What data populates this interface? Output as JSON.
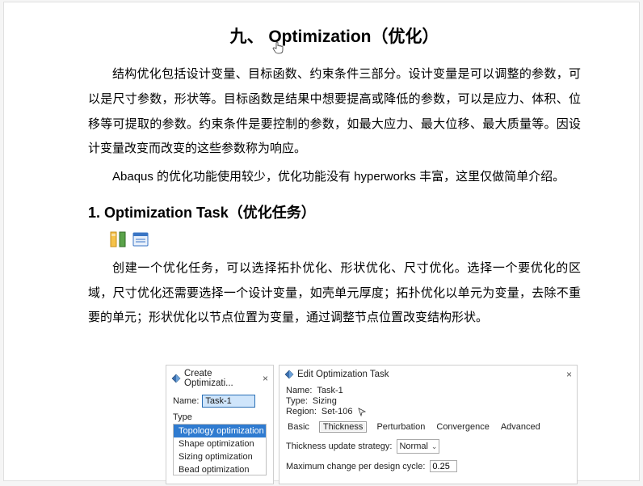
{
  "title": "九、 Optimization（优化）",
  "para1": "结构优化包括设计变量、目标函数、约束条件三部分。设计变量是可以调整的参数，可以是尺寸参数，形状等。目标函数是结果中想要提高或降低的参数，可以是应力、体积、位移等可提取的参数。约束条件是要控制的参数，如最大应力、最大位移、最大质量等。因设计变量改变而改变的这些参数称为响应。",
  "para2": "Abaqus 的优化功能使用较少，优化功能没有 hyperworks 丰富，这里仅做简单介绍。",
  "heading2": "1.  Optimization Task（优化任务）",
  "para3": "创建一个优化任务，可以选择拓扑优化、形状优化、尺寸优化。选择一个要优化的区域，尺寸优化还需要选择一个设计变量，如壳单元厚度；拓扑优化以单元为变量，去除不重要的单元；形状优化以节点位置为变量，通过调整节点位置改变结构形状。",
  "dlg1": {
    "title": "Create Optimizati...",
    "nameLabel": "Name:",
    "nameValue": "Task-1",
    "typeLabel": "Type",
    "options": [
      "Topology optimization",
      "Shape optimization",
      "Sizing optimization",
      "Bead optimization"
    ]
  },
  "dlg2": {
    "title": "Edit Optimization Task",
    "nameLabel": "Name:",
    "nameValue": "Task-1",
    "typeLabel": "Type:",
    "typeValue": "Sizing",
    "regionLabel": "Region:",
    "regionValue": "Set-106",
    "tabs": [
      "Basic",
      "Thickness",
      "Perturbation",
      "Convergence",
      "Advanced"
    ],
    "strategyLabel": "Thickness update strategy:",
    "strategyValue": "Normal",
    "maxChangeLabel": "Maximum change per design cycle:",
    "maxChangeValue": "0.25"
  }
}
